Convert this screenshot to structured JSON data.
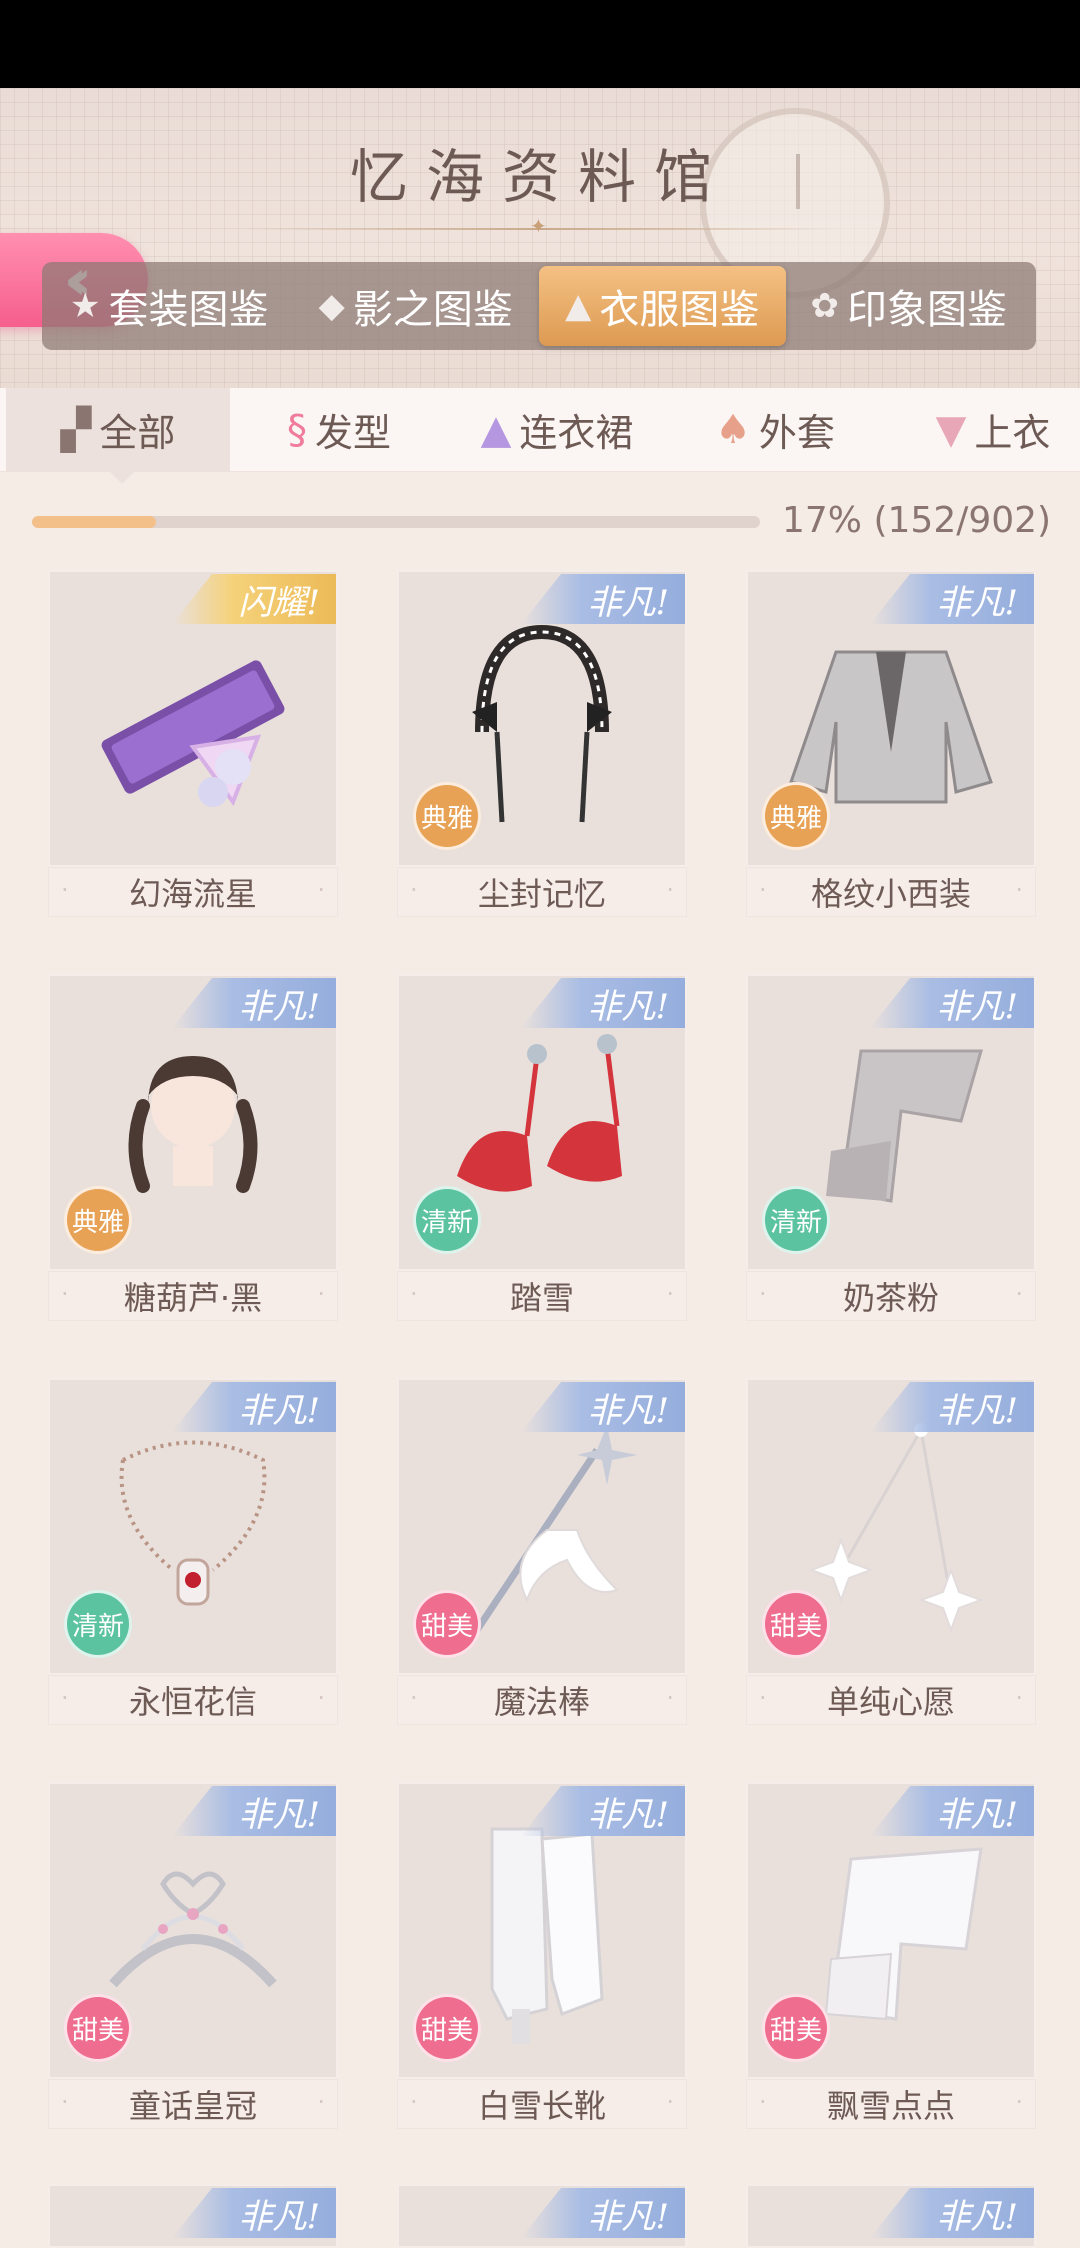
{
  "header": {
    "title": "忆海资料馆",
    "back_icon": "double-chevron-left-icon",
    "category_tabs": [
      {
        "label": "套装图鉴",
        "icon": "star-icon",
        "active": false
      },
      {
        "label": "影之图鉴",
        "icon": "cube-icon",
        "active": false
      },
      {
        "label": "衣服图鉴",
        "icon": "dress-icon",
        "active": true
      },
      {
        "label": "印象图鉴",
        "icon": "flower-icon",
        "active": false
      }
    ]
  },
  "sub_tabs": [
    {
      "label": "全部",
      "icon": "grid-icon",
      "active": true
    },
    {
      "label": "发型",
      "icon": "hair-icon",
      "active": false
    },
    {
      "label": "连衣裙",
      "icon": "dress-icon",
      "active": false
    },
    {
      "label": "外套",
      "icon": "coat-icon",
      "active": false
    },
    {
      "label": "上衣",
      "icon": "shirt-icon",
      "active": false
    }
  ],
  "progress": {
    "fraction": 0.17,
    "text": "17% (152/902)"
  },
  "items": [
    {
      "name": "幻海流星",
      "rarity": "闪耀!",
      "rarity_style": "gold",
      "tag": "",
      "tag_style": ""
    },
    {
      "name": "尘封记忆",
      "rarity": "非凡!",
      "rarity_style": "blue",
      "tag": "典雅",
      "tag_style": "elegant"
    },
    {
      "name": "格纹小西装",
      "rarity": "非凡!",
      "rarity_style": "blue",
      "tag": "典雅",
      "tag_style": "elegant"
    },
    {
      "name": "糖葫芦·黑",
      "rarity": "非凡!",
      "rarity_style": "blue",
      "tag": "典雅",
      "tag_style": "elegant"
    },
    {
      "name": "踏雪",
      "rarity": "非凡!",
      "rarity_style": "blue",
      "tag": "清新",
      "tag_style": "fresh"
    },
    {
      "name": "奶茶粉",
      "rarity": "非凡!",
      "rarity_style": "blue",
      "tag": "清新",
      "tag_style": "fresh"
    },
    {
      "name": "永恒花信",
      "rarity": "非凡!",
      "rarity_style": "blue",
      "tag": "清新",
      "tag_style": "fresh"
    },
    {
      "name": "魔法棒",
      "rarity": "非凡!",
      "rarity_style": "blue",
      "tag": "甜美",
      "tag_style": "sweet"
    },
    {
      "name": "单纯心愿",
      "rarity": "非凡!",
      "rarity_style": "blue",
      "tag": "甜美",
      "tag_style": "sweet"
    },
    {
      "name": "童话皇冠",
      "rarity": "非凡!",
      "rarity_style": "blue",
      "tag": "甜美",
      "tag_style": "sweet"
    },
    {
      "name": "白雪长靴",
      "rarity": "非凡!",
      "rarity_style": "blue",
      "tag": "甜美",
      "tag_style": "sweet"
    },
    {
      "name": "飘雪点点",
      "rarity": "非凡!",
      "rarity_style": "blue",
      "tag": "甜美",
      "tag_style": "sweet"
    }
  ],
  "partial_row": [
    {
      "rarity": "非凡!"
    },
    {
      "rarity": "非凡!"
    },
    {
      "rarity": "非凡!"
    }
  ],
  "colors": {
    "accent_pink": "#f65e8d",
    "active_tab_gold": "#dd9a52",
    "progress_fill": "#f4c08a",
    "tag_elegant": "#e8a256",
    "tag_fresh": "#5cc3a1",
    "tag_sweet": "#ef6d8e"
  }
}
